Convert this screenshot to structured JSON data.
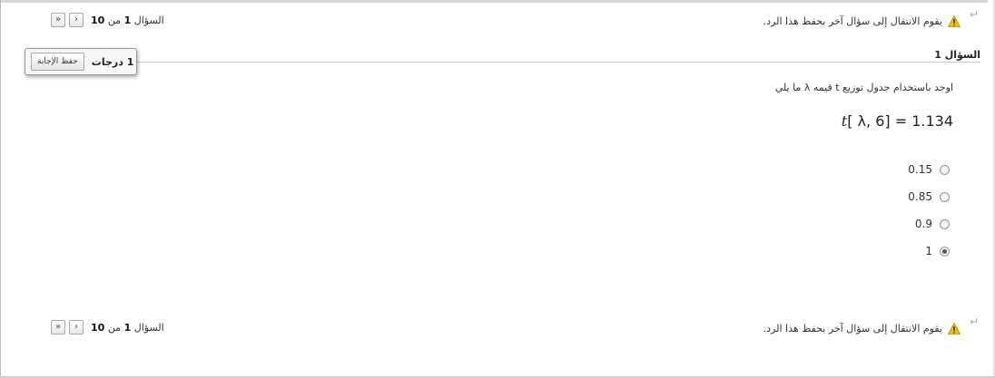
{
  "nav": {
    "question_label": "السؤال",
    "current": "1",
    "of_label": "من",
    "total": "10",
    "next_symbol": "›",
    "last_symbol": "»"
  },
  "warning": {
    "text": "يقوم الانتقال إلى سؤال آخر بحفظ هذا الرد."
  },
  "question": {
    "title": "السؤال 1",
    "points": "1 درجات",
    "save_label": "حفظ الإجابة",
    "text": "اوجد باستخدام جدول توزيع t  قيمه λ ما يلي",
    "formula_var": "t",
    "formula_rest": "[ λ, 6]  = 1.134"
  },
  "options": [
    {
      "label": "0.15",
      "selected": false
    },
    {
      "label": "0.85",
      "selected": false
    },
    {
      "label": "0.9",
      "selected": false
    },
    {
      "label": "1",
      "selected": true
    }
  ]
}
